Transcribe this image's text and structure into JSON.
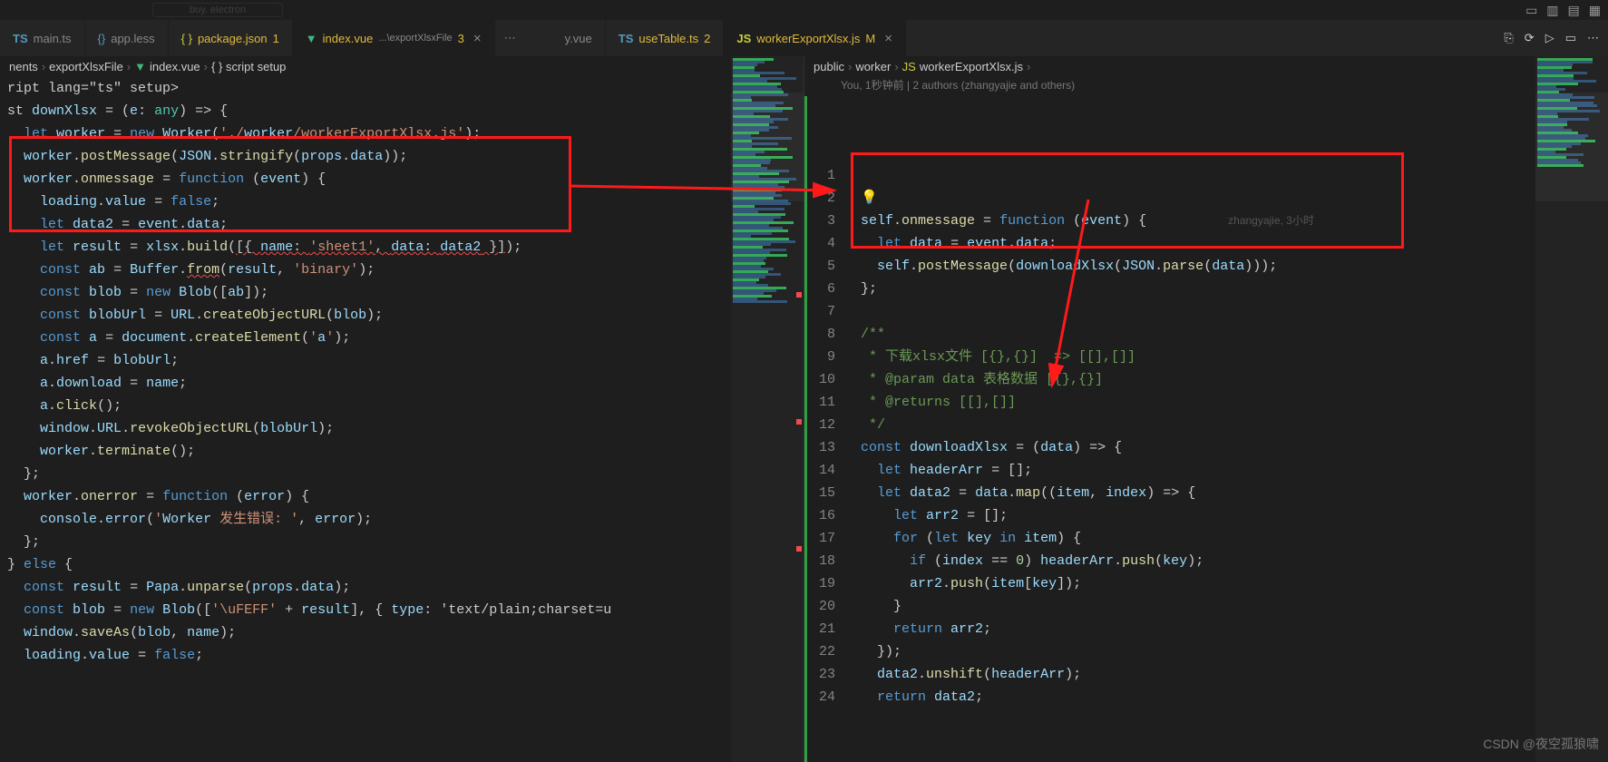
{
  "top_search": "buy. electron",
  "tabs_left": [
    {
      "icon": "ts",
      "label": "main.ts",
      "mod": "",
      "active": false
    },
    {
      "icon": "less",
      "label": "app.less",
      "mod": "",
      "active": false
    },
    {
      "icon": "json",
      "label": "package.json",
      "mod": "1",
      "active": false
    },
    {
      "icon": "vue",
      "label": "index.vue",
      "path": "...\\exportXlsxFile",
      "mod": "3",
      "active": true,
      "close": true
    }
  ],
  "tabs_left_overflow": "⋯",
  "tabs_right": [
    {
      "icon": "vue",
      "label": "y.vue",
      "mod": "",
      "active": false
    },
    {
      "icon": "ts",
      "label": "useTable.ts",
      "mod": "2",
      "active": false
    },
    {
      "icon": "js",
      "label": "workerExportXlsx.js",
      "mod": "M",
      "active": true,
      "close": true
    }
  ],
  "tab_actions": [
    "⎘",
    "⟳",
    "⋯",
    "▭",
    "⊞"
  ],
  "breadcrumb_left": [
    "nents",
    "exportXlsxFile",
    "index.vue",
    "script setup"
  ],
  "breadcrumb_right": [
    "public",
    "worker",
    "workerExportXlsx.js",
    ""
  ],
  "blame_right": "You, 1秒钟前 | 2 authors (zhangyajie and others)",
  "blame_inline_right": "zhangyajie, 3小时",
  "code_left": [
    {
      "t": "ript lang=\"ts\" setup>"
    },
    {
      "t": "st downXlsx = (e: any) => {"
    },
    {
      "t": "  let worker = new Worker('./worker/workerExportXlsx.js');"
    },
    {
      "t": "  worker.postMessage(JSON.stringify(props.data));"
    },
    {
      "t": "  worker.onmessage = function (event) {"
    },
    {
      "t": "    loading.value = false;"
    },
    {
      "t": "    let data2 = event.data;"
    },
    {
      "t": "    let result = xlsx.build([{ name: 'sheet1', data: data2 }]);"
    },
    {
      "t": "    const ab = Buffer.from(result, 'binary');"
    },
    {
      "t": "    const blob = new Blob([ab]);"
    },
    {
      "t": "    const blobUrl = URL.createObjectURL(blob);"
    },
    {
      "t": "    const a = document.createElement('a');"
    },
    {
      "t": "    a.href = blobUrl;"
    },
    {
      "t": "    a.download = name;"
    },
    {
      "t": "    a.click();"
    },
    {
      "t": "    window.URL.revokeObjectURL(blobUrl);"
    },
    {
      "t": "    worker.terminate();"
    },
    {
      "t": "  };"
    },
    {
      "t": "  worker.onerror = function (error) {"
    },
    {
      "t": "    console.error('Worker 发生错误: ', error);"
    },
    {
      "t": "  };"
    },
    {
      "t": "} else {"
    },
    {
      "t": "  const result = Papa.unparse(props.data);"
    },
    {
      "t": "  const blob = new Blob(['\\uFEFF' + result], { type: 'text/plain;charset=u"
    },
    {
      "t": "  window.saveAs(blob, name);"
    },
    {
      "t": "  loading.value = false;"
    }
  ],
  "code_right": [
    {
      "n": 1,
      "t": ""
    },
    {
      "n": 2,
      "t": "",
      "bulb": true
    },
    {
      "n": 3,
      "t": "self.onmessage = function (event) {",
      "blame": true
    },
    {
      "n": 4,
      "t": "  let data = event.data;"
    },
    {
      "n": 5,
      "t": "  self.postMessage(downloadXlsx(JSON.parse(data)));"
    },
    {
      "n": 6,
      "t": "};"
    },
    {
      "n": 7,
      "t": ""
    },
    {
      "n": 8,
      "t": "/**"
    },
    {
      "n": 9,
      "t": " * 下载xlsx文件 [{},{}]  => [[],[]]"
    },
    {
      "n": 10,
      "t": " * @param data 表格数据 [{},{}]"
    },
    {
      "n": 11,
      "t": " * @returns [[],[]]"
    },
    {
      "n": 12,
      "t": " */"
    },
    {
      "n": 13,
      "t": "const downloadXlsx = (data) => {"
    },
    {
      "n": 14,
      "t": "  let headerArr = [];"
    },
    {
      "n": 15,
      "t": "  let data2 = data.map((item, index) => {"
    },
    {
      "n": 16,
      "t": "    let arr2 = [];"
    },
    {
      "n": 17,
      "t": "    for (let key in item) {"
    },
    {
      "n": 18,
      "t": "      if (index == 0) headerArr.push(key);"
    },
    {
      "n": 19,
      "t": "      arr2.push(item[key]);"
    },
    {
      "n": 20,
      "t": "    }"
    },
    {
      "n": 21,
      "t": "    return arr2;"
    },
    {
      "n": 22,
      "t": "  });"
    },
    {
      "n": 23,
      "t": "  data2.unshift(headerArr);"
    },
    {
      "n": 24,
      "t": "  return data2;"
    }
  ],
  "watermark": "CSDN @夜空孤狼啸"
}
